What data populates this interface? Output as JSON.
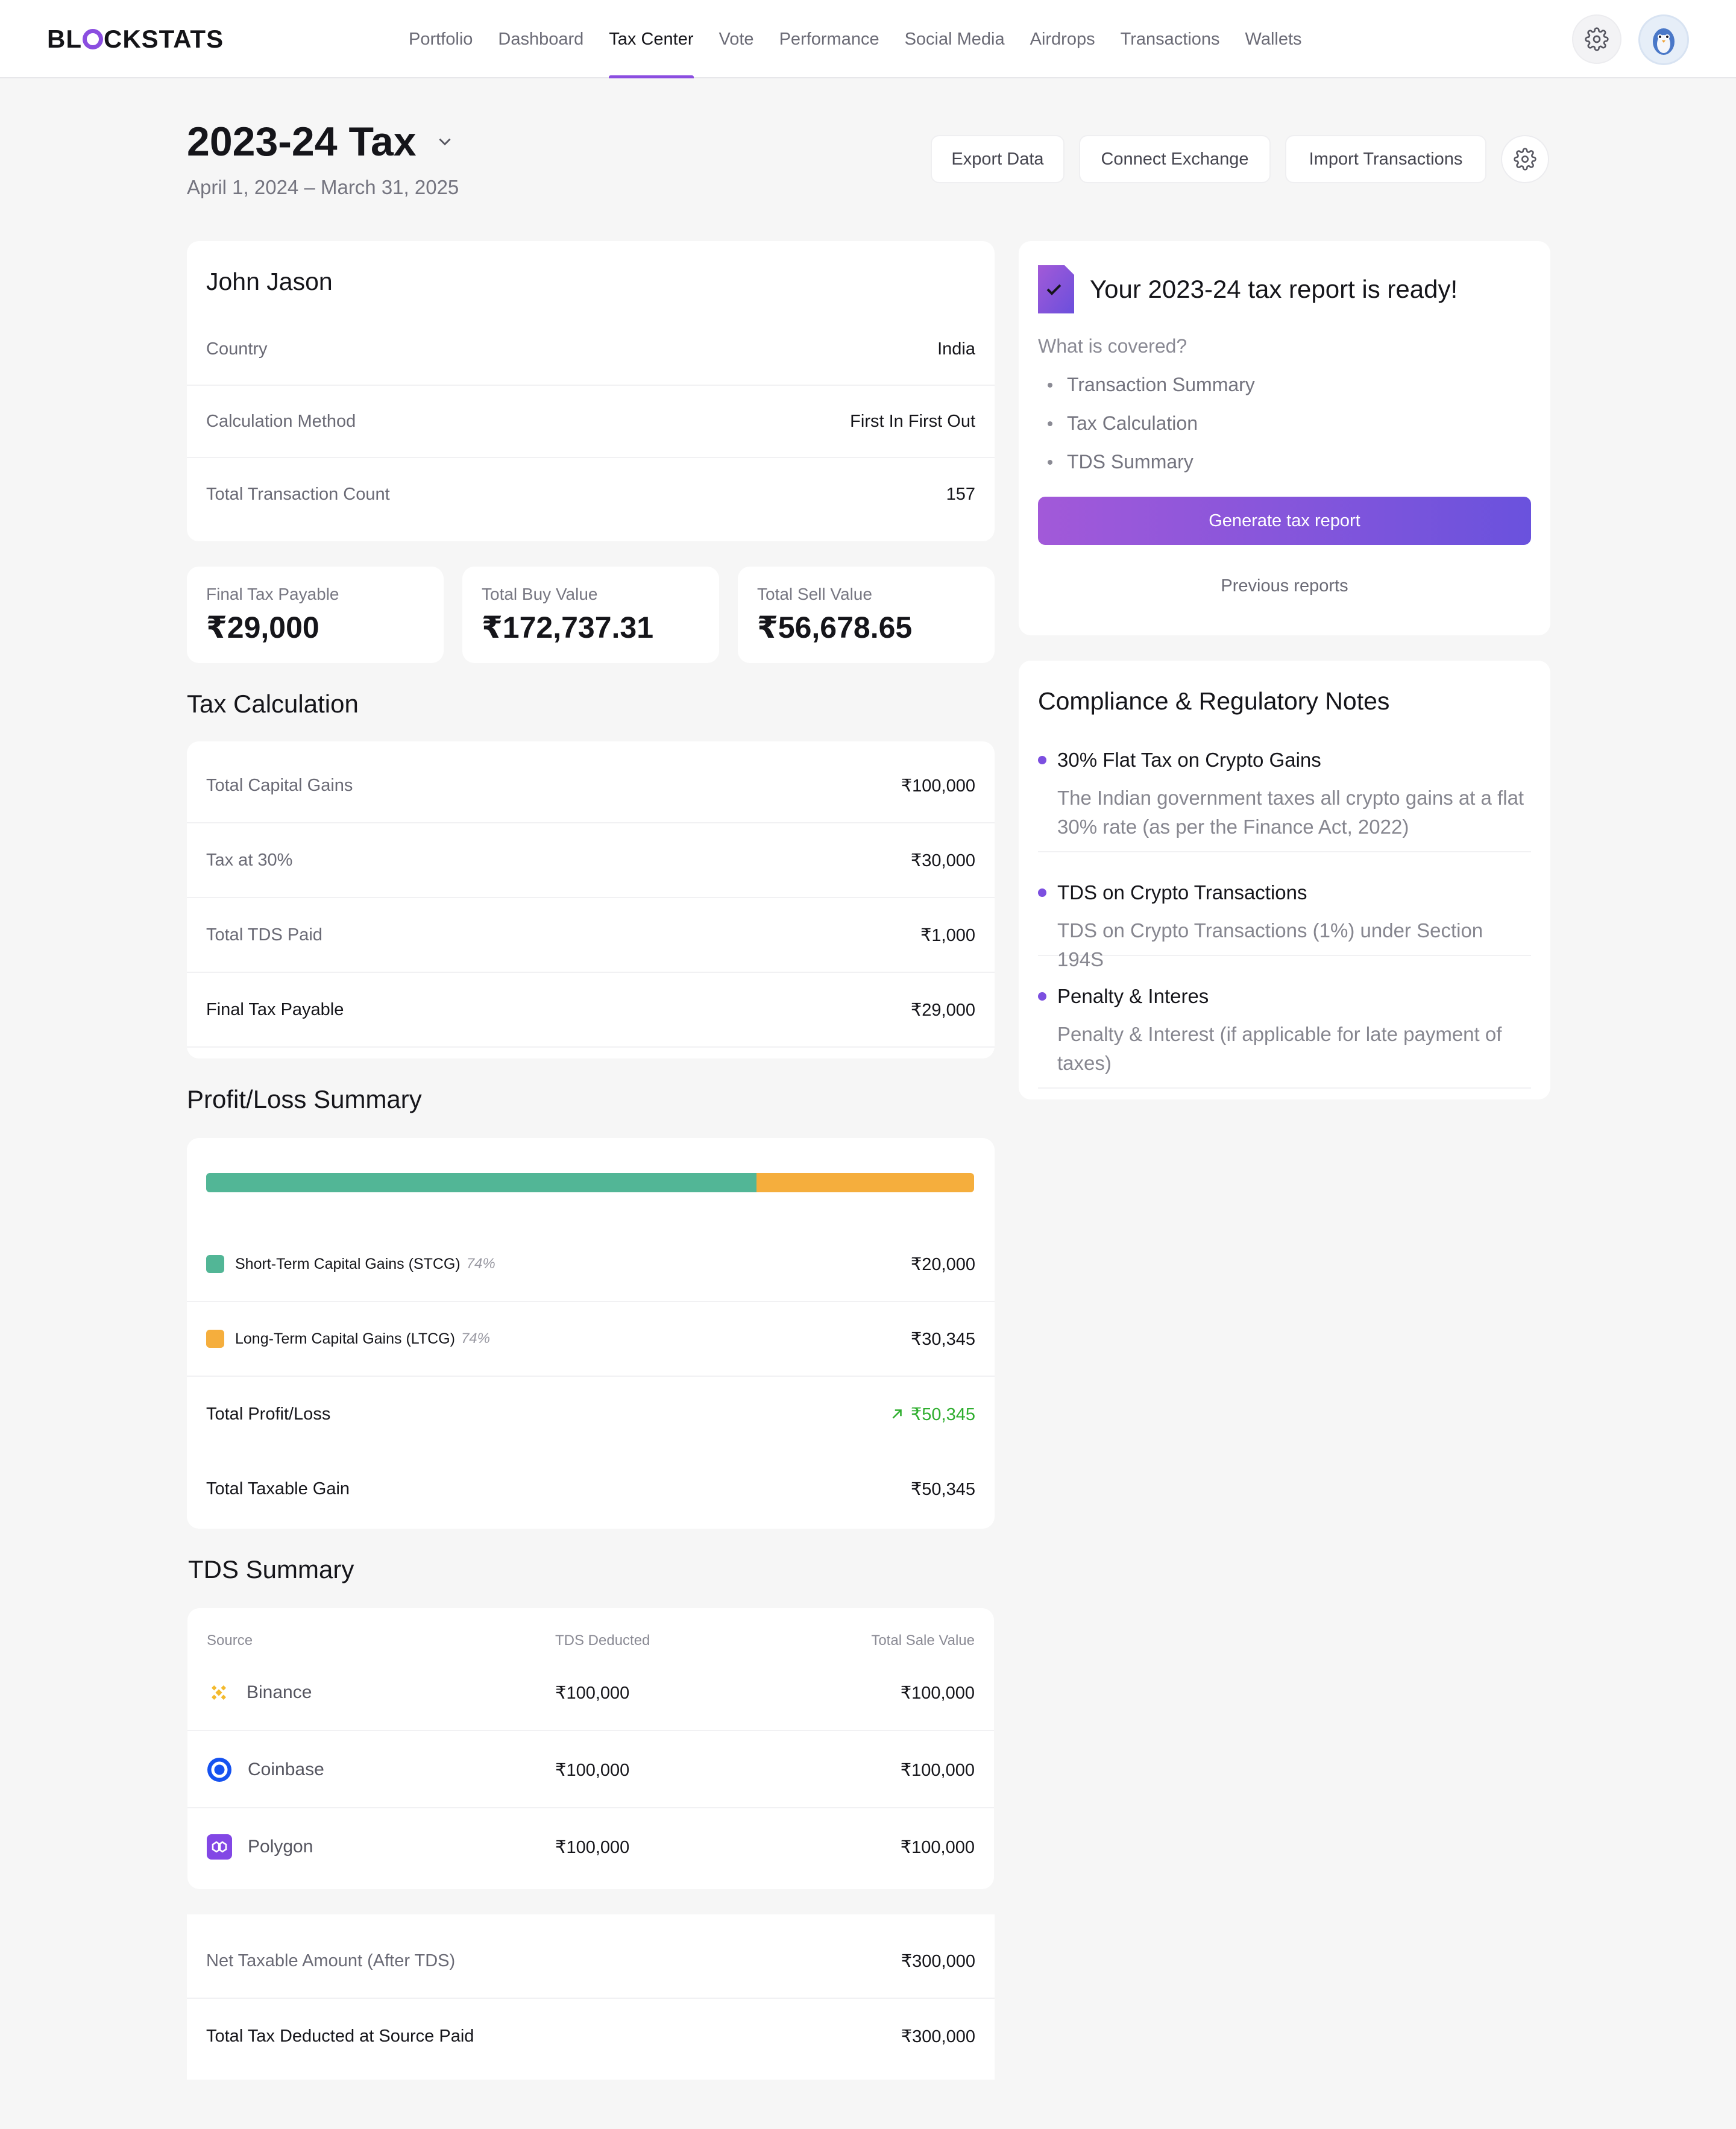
{
  "brand": {
    "logo_text_before": "BL",
    "logo_text_after": "CKSTATS",
    "accent": "#8b4ee0"
  },
  "nav": {
    "items": [
      {
        "label": "Portfolio",
        "active": false
      },
      {
        "label": "Dashboard",
        "active": false
      },
      {
        "label": "Tax Center",
        "active": true
      },
      {
        "label": "Vote",
        "active": false
      },
      {
        "label": "Performance",
        "active": false
      },
      {
        "label": "Social Media",
        "active": false
      },
      {
        "label": "Airdrops",
        "active": false
      },
      {
        "label": "Transactions",
        "active": false
      },
      {
        "label": "Wallets",
        "active": false
      }
    ],
    "settings_icon": "gear-icon",
    "avatar_icon": "avatar-icon"
  },
  "header": {
    "title": "2023-24 Tax",
    "subtitle": "April 1, 2024 – March 31, 2025",
    "export_label": "Export Data",
    "connect_label": "Connect Exchange",
    "import_label": "Import Transactions"
  },
  "profile": {
    "name": "John Jason",
    "rows": [
      {
        "label": "Country",
        "value": "India"
      },
      {
        "label": "Calculation Method",
        "value": "First In First Out"
      },
      {
        "label": "Total Transaction Count",
        "value": "157"
      }
    ]
  },
  "stats": [
    {
      "label": "Final Tax Payable",
      "value": "₹29,000"
    },
    {
      "label": "Total Buy Value",
      "value": "₹172,737.31"
    },
    {
      "label": "Total Sell Value",
      "value": "₹56,678.65"
    }
  ],
  "tax_calc": {
    "title": "Tax Calculation",
    "rows": [
      {
        "label": "Total Capital Gains",
        "value": "₹100,000"
      },
      {
        "label": "Tax at 30%",
        "value": "₹30,000"
      },
      {
        "label": "Total TDS Paid",
        "value": "₹1,000"
      },
      {
        "label": "Final Tax Payable",
        "value": "₹29,000"
      }
    ]
  },
  "profit_loss": {
    "title": "Profit/Loss Summary",
    "bar": {
      "stcg_fraction": 0.717,
      "stcg_color": "#52b696",
      "ltcg_color": "#f5ae3d"
    },
    "stcg": {
      "label": "Short-Term Capital Gains (STCG)",
      "pct": "74%",
      "value": "₹20,000"
    },
    "ltcg": {
      "label": "Long-Term Capital Gains (LTCG)",
      "pct": "74%",
      "value": "₹30,345"
    },
    "total": {
      "label": "Total Profit/Loss",
      "value": "₹50,345",
      "color": "#2fae2f"
    },
    "taxable": {
      "label": "Total Taxable Gain",
      "value": "₹50,345"
    }
  },
  "tds": {
    "title": "TDS Summary",
    "headers": {
      "source": "Source",
      "deducted": "TDS Deducted",
      "sale": "Total Sale Value"
    },
    "rows": [
      {
        "source": "Binance",
        "deducted": "₹100,000",
        "sale": "₹100,000",
        "icon": "binance-icon"
      },
      {
        "source": "Coinbase",
        "deducted": "₹100,000",
        "sale": "₹100,000",
        "icon": "coinbase-icon"
      },
      {
        "source": "Polygon",
        "deducted": "₹100,000",
        "sale": "₹100,000",
        "icon": "polygon-icon"
      }
    ],
    "net": {
      "label": "Net Taxable Amount (After TDS)",
      "value": "₹300,000"
    },
    "total": {
      "label": "Total Tax Deducted at Source Paid",
      "value": "₹300,000"
    }
  },
  "report": {
    "title": "Your 2023-24 tax report is ready!",
    "covered_label": "What is covered?",
    "covered_items": [
      "Transaction Summary",
      "Tax Calculation",
      "TDS Summary"
    ],
    "generate_label": "Generate tax report",
    "previous_label": "Previous reports"
  },
  "compliance": {
    "title": "Compliance & Regulatory Notes",
    "notes": [
      {
        "title": "30% Flat Tax on Crypto Gains",
        "text": "The Indian government taxes all crypto gains at a flat 30% rate (as per the Finance Act, 2022)"
      },
      {
        "title": "TDS on Crypto Transactions",
        "text": "TDS on Crypto Transactions (1%) under Section 194S"
      },
      {
        "title": "Penalty & Interes",
        "text": "Penalty & Interest (if applicable for late payment of taxes)"
      }
    ]
  }
}
